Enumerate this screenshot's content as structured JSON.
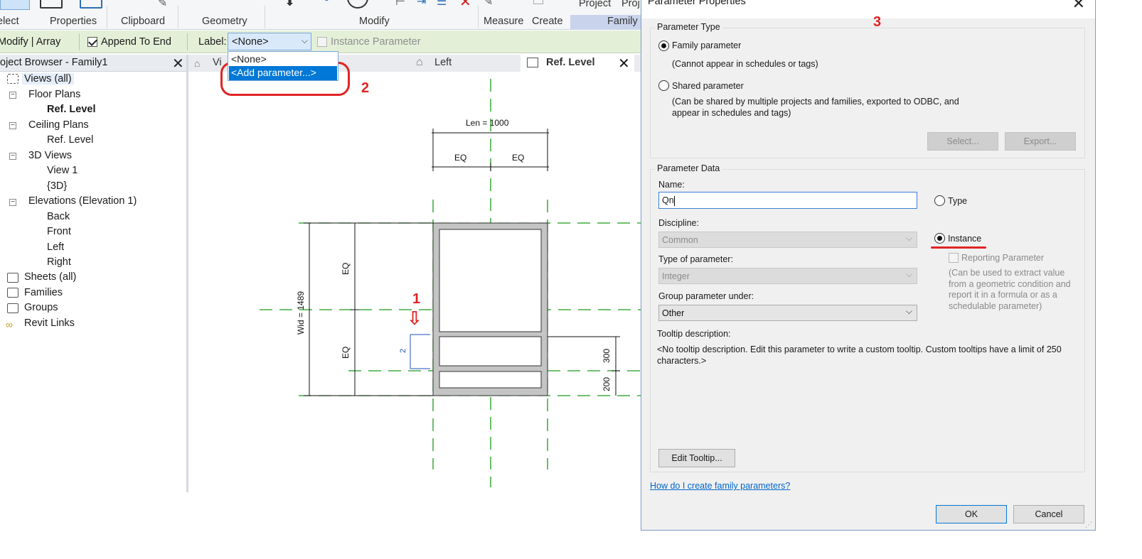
{
  "ribbon": {
    "labels": [
      "elect",
      "Properties",
      "Clipboard",
      "Geometry",
      "Modify",
      "Measure",
      "Create",
      "Family"
    ],
    "top_labels": [
      "Project",
      "Proj"
    ]
  },
  "options_bar": {
    "context": "Modify | Array",
    "append_label": "Append To End",
    "append_checked": true,
    "label_caption": "Label:",
    "label_value": "<None>",
    "instance_label": "Instance Parameter",
    "dropdown_options": [
      "<None>",
      "<Add parameter...>"
    ],
    "dropdown_selected": "<Add parameter...>"
  },
  "project_browser": {
    "title": "oject Browser - Family1",
    "items": [
      {
        "label": "Views (all)"
      },
      {
        "label": "Floor Plans"
      },
      {
        "label": "Ref. Level"
      },
      {
        "label": "Ceiling Plans"
      },
      {
        "label": "Ref. Level"
      },
      {
        "label": "3D Views"
      },
      {
        "label": "View 1"
      },
      {
        "label": "{3D}"
      },
      {
        "label": "Elevations (Elevation 1)"
      },
      {
        "label": "Back"
      },
      {
        "label": "Front"
      },
      {
        "label": "Left"
      },
      {
        "label": "Right"
      },
      {
        "label": "Sheets (all)"
      },
      {
        "label": "Families"
      },
      {
        "label": "Groups"
      },
      {
        "label": "Revit Links"
      }
    ]
  },
  "view_tabs": [
    "Vi",
    "Left",
    "Ref. Level"
  ],
  "drawing": {
    "len_label": "Len = 1000",
    "eq": "EQ",
    "wid_label": "Wid = 1489",
    "dim_300": "300",
    "dim_200": "200",
    "array_count": "2"
  },
  "annotations": {
    "step1": "1",
    "step2": "2",
    "step3": "3"
  },
  "dialog": {
    "title": "Parameter Properties",
    "parameter_type_group": "Parameter Type",
    "family_param": "Family parameter",
    "family_param_note": "(Cannot appear in schedules or tags)",
    "shared_param": "Shared parameter",
    "shared_param_note": "(Can be shared by multiple projects and families, exported to ODBC, and appear in schedules and tags)",
    "select_btn": "Select...",
    "export_btn": "Export...",
    "parameter_data_group": "Parameter Data",
    "name_label": "Name:",
    "name_value": "Qn",
    "type_radio": "Type",
    "instance_radio": "Instance",
    "discipline_label": "Discipline:",
    "discipline_value": "Common",
    "type_of_param_label": "Type of parameter:",
    "type_of_param_value": "Integer",
    "group_label": "Group parameter under:",
    "group_value": "Other",
    "reporting_label": "Reporting Parameter",
    "reporting_note": "(Can be used to extract value from a geometric condition and report it in a formula or as a schedulable parameter)",
    "tooltip_label": "Tooltip description:",
    "tooltip_text": "<No tooltip description. Edit this parameter to write a custom tooltip. Custom tooltips have a limit of 250 characters.>",
    "edit_tooltip_btn": "Edit Tooltip...",
    "help_link": "How do I create family parameters?",
    "ok_btn": "OK",
    "cancel_btn": "Cancel"
  },
  "colors": {
    "accent": "#0078d7",
    "annotation_red": "#e02424",
    "ref_plane_green": "#1a9a1a",
    "dim_blue": "#1f4fbf"
  }
}
